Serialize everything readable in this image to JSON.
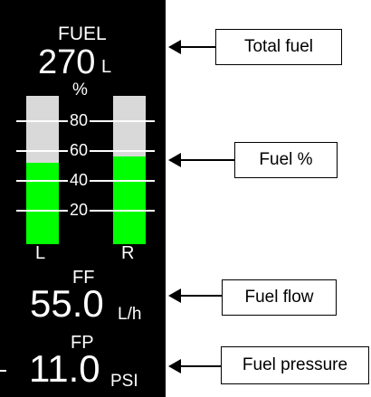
{
  "gauge": {
    "fuel_title": "FUEL",
    "fuel_value": "270",
    "fuel_unit": "L",
    "percent_symbol": "%",
    "scale_labels": [
      "80",
      "60",
      "40",
      "20"
    ],
    "left_label": "L",
    "right_label": "R",
    "left_level_percent": 55,
    "right_level_percent": 59,
    "ff_title": "FF",
    "ff_value": "55.0",
    "ff_unit": "L/h",
    "fp_title": "FP",
    "fp_value": "11.0",
    "fp_unit": "PSI"
  },
  "callouts": {
    "total_fuel": "Total fuel",
    "fuel_percent": "Fuel %",
    "fuel_flow": "Fuel flow",
    "fuel_pressure": "Fuel pressure"
  },
  "colors": {
    "background": "#000000",
    "text": "#ffffff",
    "fuel_fill": "#00ff00",
    "tank_empty": "#d9d9d9"
  }
}
